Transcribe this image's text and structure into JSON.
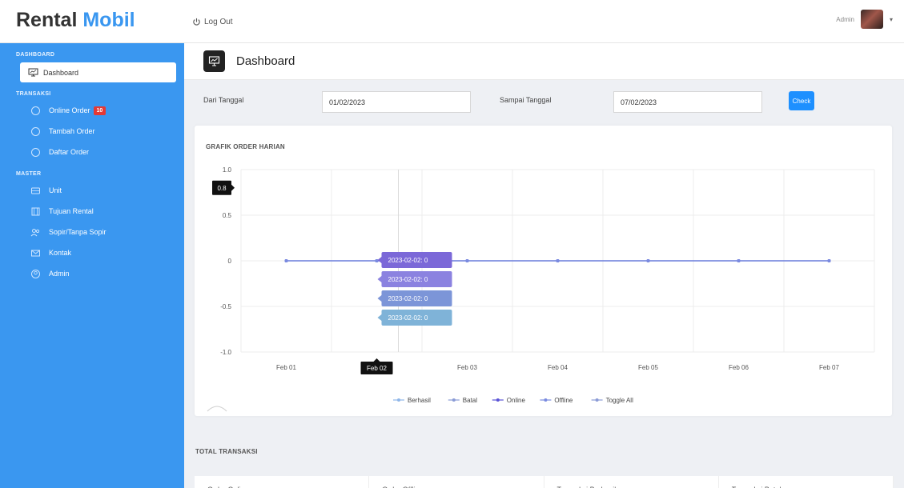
{
  "brand": {
    "prefix": "Rental",
    "accent": "Mobil"
  },
  "topbar": {
    "logout_label": "Log Out",
    "user_name": "Admin"
  },
  "sidebar": {
    "header_dashboard": "DASHBOARD",
    "dashboard_label": "Dashboard",
    "header_transaksi": "TRANSAKSI",
    "online_order_label": "Online Order",
    "online_order_badge": "10",
    "tambah_order_label": "Tambah Order",
    "daftar_order_label": "Daftar Order",
    "header_master": "MASTER",
    "unit_label": "Unit",
    "tujuan_label": "Tujuan Rental",
    "sopir_label": "Sopir/Tanpa Sopir",
    "kontak_label": "Kontak",
    "admin_label": "Admin"
  },
  "page": {
    "title": "Dashboard"
  },
  "filter": {
    "dari_label": "Dari Tanggal",
    "dari_value": "01/02/2023",
    "sampai_label": "Sampai Tanggal",
    "sampai_value": "07/02/2023",
    "check_label": "Check"
  },
  "chart_data": {
    "type": "line",
    "title": "GRAFIK ORDER HARIAN",
    "categories": [
      "Feb 01",
      "Feb 02",
      "Feb 03",
      "Feb 04",
      "Feb 05",
      "Feb 06",
      "Feb 07"
    ],
    "ylim": [
      -1.0,
      1.0
    ],
    "y_ticks": [
      "1.0",
      "0.5",
      "0",
      "-0.5",
      "-1.0"
    ],
    "series": [
      {
        "name": "Berhasil",
        "values": [
          0,
          0,
          0,
          0,
          0,
          0,
          0
        ],
        "color": "#8fb6e8"
      },
      {
        "name": "Batal",
        "values": [
          0,
          0,
          0,
          0,
          0,
          0,
          0
        ],
        "color": "#8a9bd6"
      },
      {
        "name": "Online",
        "values": [
          0,
          0,
          0,
          0,
          0,
          0,
          0
        ],
        "color": "#5b54d6"
      },
      {
        "name": "Offline",
        "values": [
          0,
          0,
          0,
          0,
          0,
          0,
          0
        ],
        "color": "#7a8be0"
      }
    ],
    "toggle_label": "Toggle All",
    "hover_y_label": "0.8",
    "hover_x_label": "Feb 02",
    "tooltips": [
      "2023-02-02: 0",
      "2023-02-02: 0",
      "2023-02-02: 0",
      "2023-02-02: 0"
    ],
    "tooltip_colors": [
      "#7b68d8",
      "#8b82e0",
      "#7c95d8",
      "#7fb3d8"
    ]
  },
  "totals": {
    "title": "TOTAL TRANSAKSI",
    "cards": [
      "Order Online",
      "Order Offline",
      "Transaksi Berhasil",
      "Transaksi Batal"
    ]
  }
}
